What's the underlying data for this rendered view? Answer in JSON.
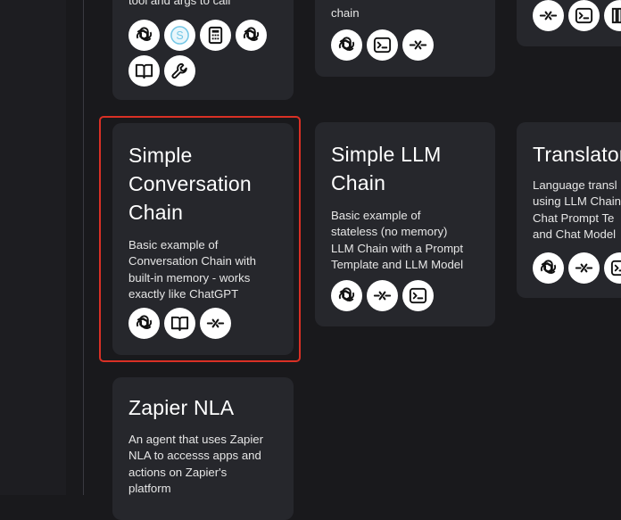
{
  "top_cards": {
    "left_partial_text": "tool and args to call",
    "middle_partial_text": "chain"
  },
  "cards": {
    "simple_conversation": {
      "title": "Simple\nConversation\nChain",
      "description": "Basic example of\nConversation Chain with\nbuilt-in memory - works\nexactly like ChatGPT"
    },
    "simple_llm": {
      "title": "Simple LLM\nChain",
      "description": "Basic example of\nstateless (no memory)\nLLM Chain with a Prompt\nTemplate and LLM Model"
    },
    "translator": {
      "title": "Translator",
      "description": "Language transl\nusing LLM Chain\nChat Prompt Te\nand Chat Model"
    },
    "zapier": {
      "title": "Zapier NLA",
      "description": "An agent that uses Zapier\nNLA to accesss apps and\nactions on Zapier's\nplatform"
    }
  },
  "icons": {
    "top_left": [
      "openai-icon",
      "serpapi-icon",
      "calculator-icon",
      "openai-icon",
      "book-icon",
      "wrench-icon"
    ],
    "top_middle": [
      "openai-icon",
      "terminal-icon",
      "chain-link-icon"
    ],
    "top_right": [
      "chain-link-icon",
      "terminal-icon",
      "library-icon"
    ],
    "simple_conversation": [
      "openai-icon",
      "book-icon",
      "chain-link-icon"
    ],
    "simple_llm": [
      "openai-icon",
      "chain-link-icon",
      "terminal-icon"
    ],
    "translator": [
      "openai-icon",
      "chain-link-icon",
      "terminal-icon"
    ]
  },
  "colors": {
    "background": "#19191c",
    "card": "#26272c",
    "selection_outline": "#d93025",
    "serp_icon": "#74c7e6"
  }
}
